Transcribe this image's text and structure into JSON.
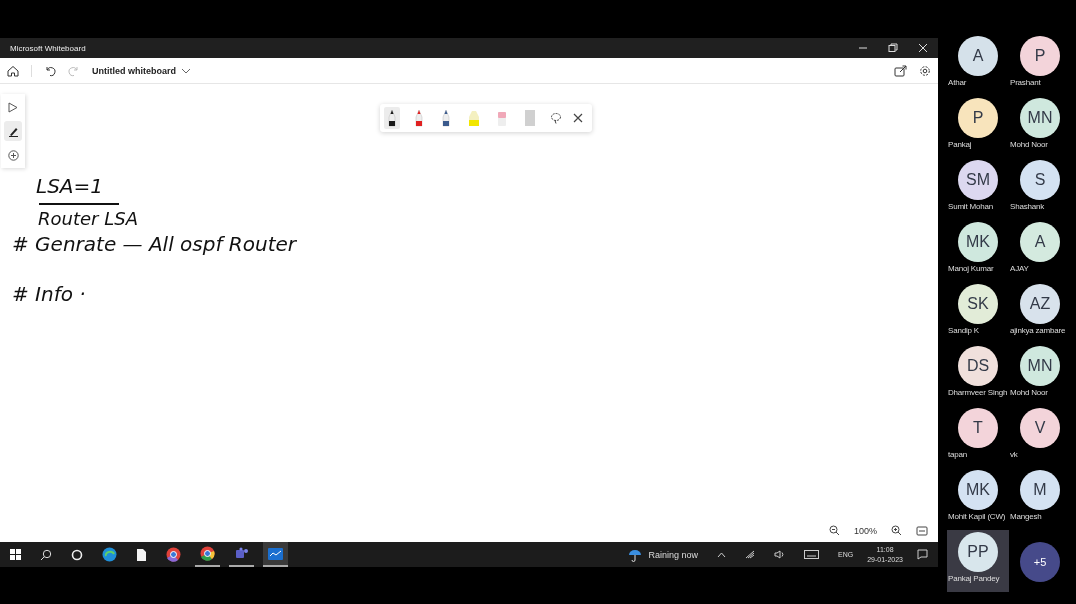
{
  "window": {
    "title": "Microsoft Whiteboard"
  },
  "toolbar": {
    "board_title": "Untitled whiteboard"
  },
  "left_tools": [
    {
      "kind": "select",
      "selected": false
    },
    {
      "kind": "pen",
      "selected": true
    },
    {
      "kind": "add",
      "selected": false
    }
  ],
  "pens": [
    {
      "kind": "pen",
      "color": "#1a1a1a",
      "selected": true
    },
    {
      "kind": "pen",
      "color": "#e02020",
      "selected": false
    },
    {
      "kind": "pen",
      "color": "#3a5a8c",
      "selected": false
    },
    {
      "kind": "highlighter",
      "color": "#f2e600",
      "selected": false
    },
    {
      "kind": "eraser",
      "color": "#f0a8b8",
      "selected": false
    },
    {
      "kind": "ruler",
      "color": "#d0d0d0",
      "selected": false
    }
  ],
  "ink": [
    "LSA=1",
    "Router LSA",
    "# Genrate — All ospf Router",
    "# Info ·"
  ],
  "zoom": {
    "level_text": "100%"
  },
  "taskbar": {
    "weather": "Raining now",
    "language": "ENG",
    "time": "11:08",
    "date": "29-01-2023"
  },
  "participants": [
    {
      "initials": "A",
      "name": "Athar",
      "color": "#d5e1ea",
      "selected": false
    },
    {
      "initials": "P",
      "name": "Prashant",
      "color": "#f3d4da",
      "selected": false
    },
    {
      "initials": "P",
      "name": "Pankaj",
      "color": "#f8e4bc",
      "selected": false
    },
    {
      "initials": "MN",
      "name": "Mohd Noor",
      "color": "#cfe8de",
      "selected": false
    },
    {
      "initials": "SM",
      "name": "Sumit Mohan",
      "color": "#dcd8f0",
      "selected": false
    },
    {
      "initials": "S",
      "name": "Shashank",
      "color": "#d4e2f2",
      "selected": false
    },
    {
      "initials": "MK",
      "name": "Manoj Kumar",
      "color": "#cfe8de",
      "selected": false
    },
    {
      "initials": "A",
      "name": "AJAY",
      "color": "#d4eadf",
      "selected": false
    },
    {
      "initials": "SK",
      "name": "Sandip K",
      "color": "#e2ecd8",
      "selected": false
    },
    {
      "initials": "AZ",
      "name": "ajinkya zambare",
      "color": "#d8e2ec",
      "selected": false
    },
    {
      "initials": "DS",
      "name": "Dharmveer Singh",
      "color": "#f0e0dc",
      "selected": false
    },
    {
      "initials": "MN",
      "name": "Mohd Noor",
      "color": "#cfe8de",
      "selected": false
    },
    {
      "initials": "T",
      "name": "tapan",
      "color": "#f3d4da",
      "selected": false
    },
    {
      "initials": "V",
      "name": "vk",
      "color": "#f3d4da",
      "selected": false
    },
    {
      "initials": "MK",
      "name": "Mohit Kapil (CW)",
      "color": "#d4e2f2",
      "selected": false
    },
    {
      "initials": "M",
      "name": "Mangesh",
      "color": "#d4e2f2",
      "selected": false
    },
    {
      "initials": "PP",
      "name": "Pankaj Pandey",
      "color": "#d8e6ec",
      "selected": true
    }
  ],
  "more_participants": "+5"
}
